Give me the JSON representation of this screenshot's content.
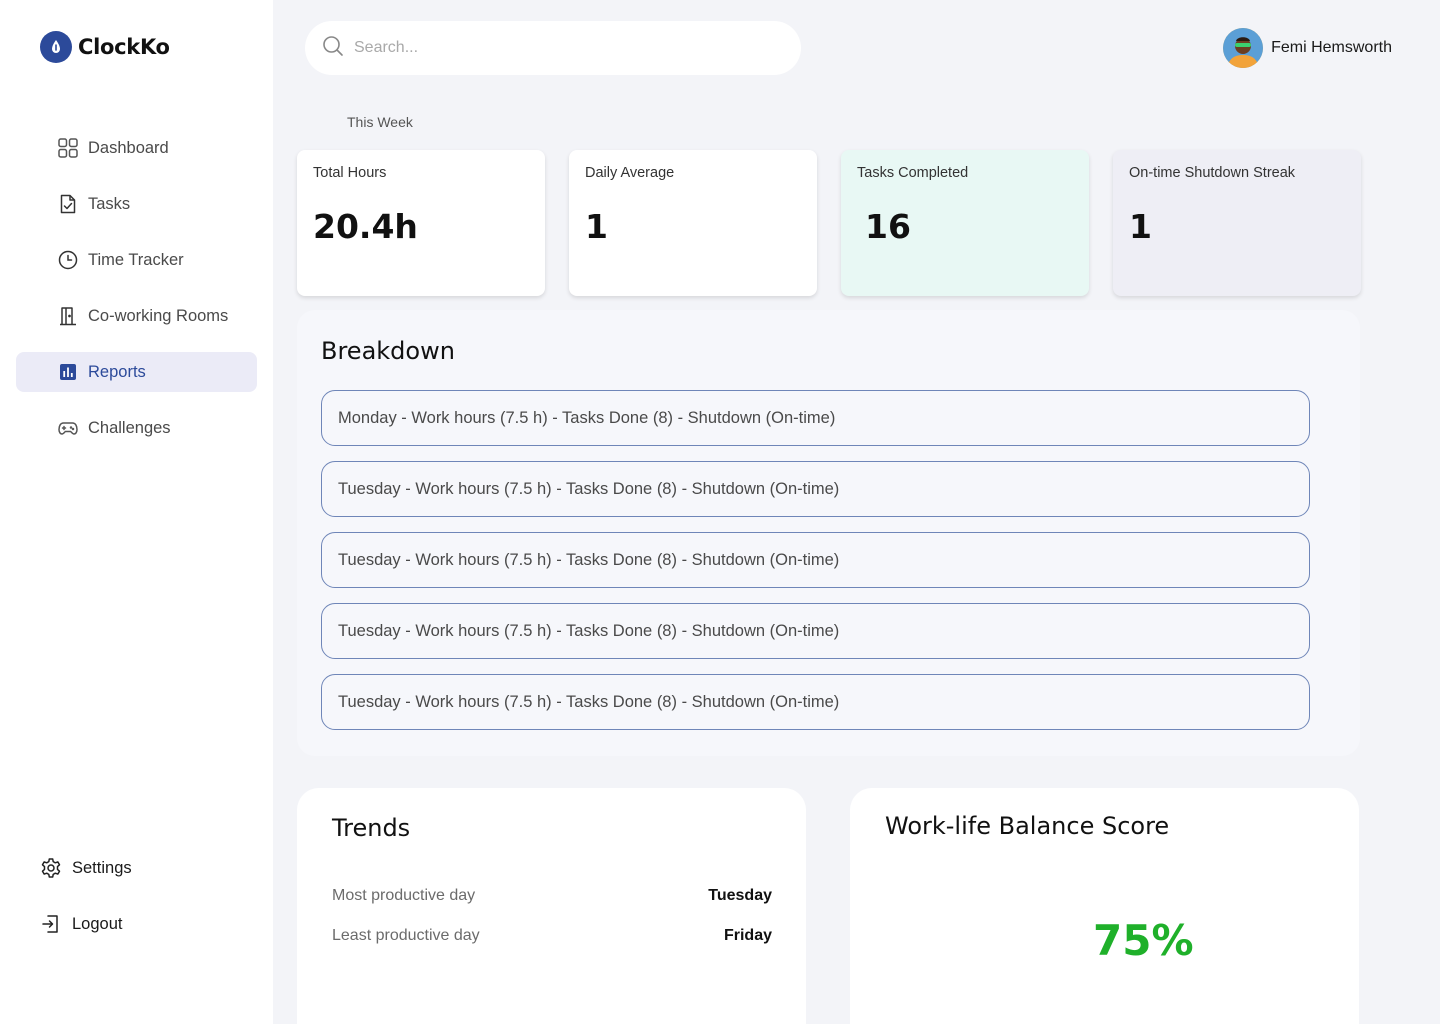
{
  "app": {
    "name": "ClockKo"
  },
  "sidebar": {
    "items": [
      {
        "label": "Dashboard",
        "icon": "grid-icon",
        "active": false
      },
      {
        "label": "Tasks",
        "icon": "task-file-icon",
        "active": false
      },
      {
        "label": "Time Tracker",
        "icon": "clock-icon",
        "active": false
      },
      {
        "label": "Co-working Rooms",
        "icon": "door-icon",
        "active": false
      },
      {
        "label": "Reports",
        "icon": "bar-chart-icon",
        "active": true
      },
      {
        "label": "Challenges",
        "icon": "gamepad-icon",
        "active": false
      }
    ],
    "bottom": [
      {
        "label": "Settings",
        "icon": "gear-icon"
      },
      {
        "label": "Logout",
        "icon": "logout-icon"
      }
    ]
  },
  "header": {
    "search_placeholder": "Search...",
    "user_name": "Femi Hemsworth"
  },
  "period": "This Week",
  "stats": [
    {
      "label": "Total Hours",
      "value": "20.4h",
      "bg": "#ffffff"
    },
    {
      "label": "Daily Average",
      "value": "1",
      "bg": "#ffffff"
    },
    {
      "label": "Tasks Completed",
      "value": "16",
      "bg": "#e8f8f4"
    },
    {
      "label": "On-time Shutdown Streak",
      "value": "1",
      "bg": "#eeeef5"
    }
  ],
  "breakdown": {
    "title": "Breakdown",
    "rows": [
      "Monday - Work hours (7.5 h) - Tasks Done (8) - Shutdown (On-time)",
      "Tuesday - Work hours (7.5 h) - Tasks Done (8) - Shutdown (On-time)",
      "Tuesday - Work hours (7.5 h) - Tasks Done (8) - Shutdown (On-time)",
      "Tuesday - Work hours (7.5 h) - Tasks Done (8) - Shutdown (On-time)",
      "Tuesday - Work hours (7.5 h) - Tasks Done (8) - Shutdown (On-time)"
    ]
  },
  "trends": {
    "title": "Trends",
    "rows": [
      {
        "key": "Most productive day",
        "value": "Tuesday"
      },
      {
        "key": "Least productive day",
        "value": "Friday"
      }
    ]
  },
  "balance": {
    "title": "Work-life Balance Score",
    "score": "75%"
  },
  "colors": {
    "brand": "#2c4a9a",
    "active_bg": "#ebebf7",
    "score": "#1fb02a",
    "row_border": "#6f86b8"
  }
}
